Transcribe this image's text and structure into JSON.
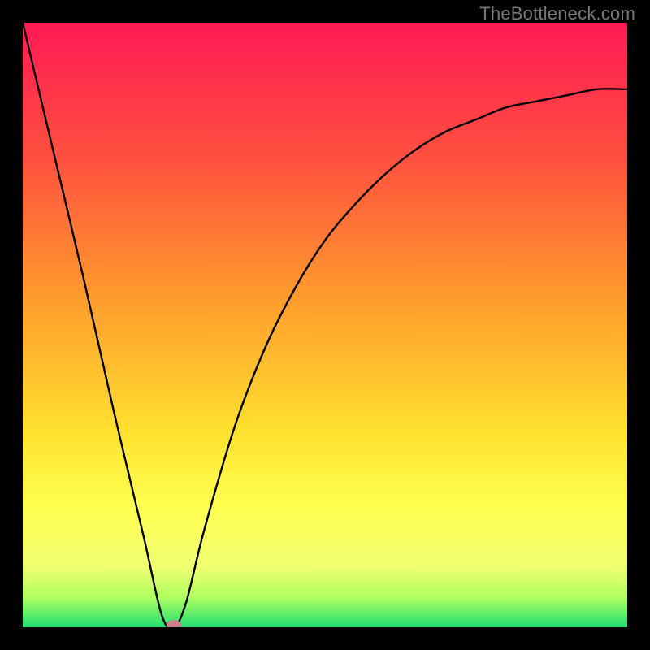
{
  "watermark": "TheBottleneck.com",
  "chart_data": {
    "type": "line",
    "title": "",
    "xlabel": "",
    "ylabel": "",
    "xlim": [
      0,
      100
    ],
    "ylim": [
      0,
      100
    ],
    "x": [
      0,
      5,
      10,
      15,
      20,
      23,
      25,
      27,
      30,
      35,
      40,
      45,
      50,
      55,
      60,
      65,
      70,
      75,
      80,
      85,
      90,
      95,
      100
    ],
    "values": [
      100,
      79,
      58,
      36,
      15,
      2,
      0,
      4,
      16,
      33,
      46,
      56,
      64,
      70,
      75,
      79,
      82,
      84,
      86,
      87,
      88,
      89,
      89
    ],
    "minimum_x": 25,
    "marker": {
      "x": 25,
      "y": 0,
      "color": "#cf7e8b"
    },
    "background_gradient": {
      "stops": [
        {
          "offset": 0.0,
          "color": "#ff1a55"
        },
        {
          "offset": 0.22,
          "color": "#ff4f3f"
        },
        {
          "offset": 0.45,
          "color": "#ff9a2d"
        },
        {
          "offset": 0.68,
          "color": "#ffe22e"
        },
        {
          "offset": 0.8,
          "color": "#ffff50"
        },
        {
          "offset": 0.9,
          "color": "#f0ff70"
        },
        {
          "offset": 0.95,
          "color": "#b0ff60"
        },
        {
          "offset": 1.0,
          "color": "#20e070"
        }
      ]
    },
    "curve_color": "#000000",
    "curve_width": 2.4
  }
}
